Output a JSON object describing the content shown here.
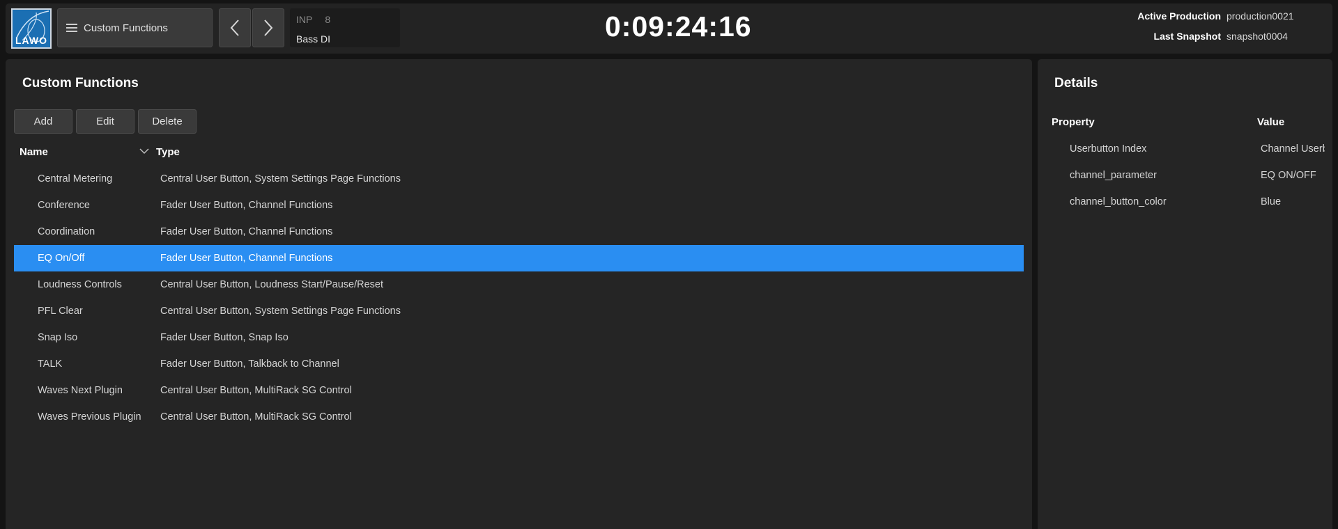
{
  "brand": {
    "logo_text": "LAWO",
    "color": "#1b6fb3"
  },
  "topbar": {
    "menu_label": "Custom Functions",
    "menu_icon": "hamburger-icon",
    "prev_icon": "chevron-left-icon",
    "next_icon": "chevron-right-icon",
    "channel": {
      "type": "INP",
      "number": "8",
      "name": "Bass DI"
    },
    "timecode": "0:09:24:16",
    "production": {
      "active_label": "Active Production",
      "active_value": "production0021",
      "snapshot_label": "Last Snapshot",
      "snapshot_value": "snapshot0004"
    }
  },
  "main": {
    "title": "Custom Functions",
    "buttons": {
      "add": "Add",
      "edit": "Edit",
      "delete": "Delete"
    },
    "columns": {
      "name": "Name",
      "type": "Type"
    },
    "rows": [
      {
        "name": "Central Metering",
        "type": "Central User Button, System Settings Page Functions"
      },
      {
        "name": "Conference",
        "type": "Fader User Button, Channel Functions"
      },
      {
        "name": "Coordination",
        "type": "Fader User Button, Channel Functions"
      },
      {
        "name": "EQ On/Off",
        "type": "Fader User Button, Channel Functions",
        "selected": true
      },
      {
        "name": "Loudness Controls",
        "type": "Central User Button, Loudness Start/Pause/Reset"
      },
      {
        "name": "PFL Clear",
        "type": "Central User Button, System Settings Page Functions"
      },
      {
        "name": "Snap Iso",
        "type": "Fader User Button, Snap Iso"
      },
      {
        "name": "TALK",
        "type": "Fader User Button, Talkback to Channel"
      },
      {
        "name": "Waves Next Plugin",
        "type": "Central User Button, MultiRack SG Control"
      },
      {
        "name": "Waves Previous Plugin",
        "type": "Central User Button, MultiRack SG Control"
      }
    ],
    "selection_color": "#2a8ef2"
  },
  "details": {
    "title": "Details",
    "columns": {
      "property": "Property",
      "value": "Value"
    },
    "rows": [
      {
        "property": "Userbutton Index",
        "value": "Channel Userb"
      },
      {
        "property": "channel_parameter",
        "value": "EQ ON/OFF"
      },
      {
        "property": "channel_button_color",
        "value": "Blue"
      }
    ]
  }
}
